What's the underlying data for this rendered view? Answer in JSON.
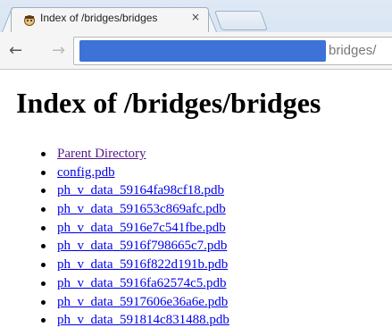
{
  "browser": {
    "tab_title": "Index of /bridges/bridges",
    "tab_close": "×",
    "url_visible": "bridges/"
  },
  "page": {
    "title": "Index of /bridges/bridges",
    "entries": [
      "Parent Directory",
      "config.pdb",
      "ph_v_data_59164fa98cf18.pdb",
      "ph_v_data_591653c869afc.pdb",
      "ph_v_data_5916e7c541fbe.pdb",
      "ph_v_data_5916f798665c7.pdb",
      "ph_v_data_5916f822d191b.pdb",
      "ph_v_data_5916fa62574c5.pdb",
      "ph_v_data_5917606e36a6e.pdb",
      "ph_v_data_591814c831488.pdb"
    ]
  },
  "colors": {
    "link": "#0000ee",
    "visited_link": "#551a8b",
    "url_redaction": "#3d72d6"
  }
}
